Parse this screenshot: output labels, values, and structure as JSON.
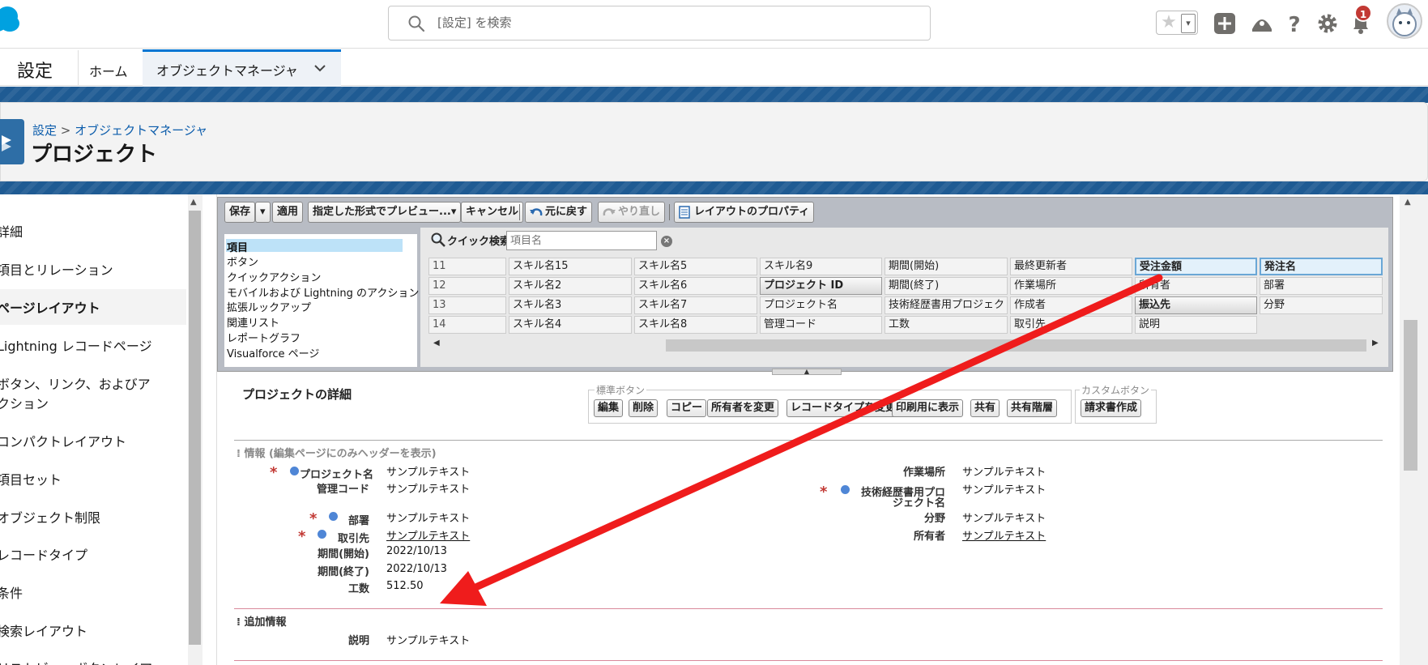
{
  "header": {
    "search_placeholder": "[設定] を検索",
    "notification_count": "1",
    "fav_star": "★",
    "fav_dropdown": "▾"
  },
  "appnav": {
    "app_name": "設定",
    "home": "ホーム",
    "object_manager": "オブジェクトマネージャ"
  },
  "page": {
    "breadcrumb_root": "設定",
    "breadcrumb_sep": " > ",
    "breadcrumb_current": "オブジェクトマネージャ",
    "title": "プロジェクト"
  },
  "leftnav": [
    "詳細",
    "項目とリレーション",
    "ページレイアウト",
    "Lightning レコードページ",
    "ボタン、リンク、およびア",
    "クション",
    "コンパクトレイアウト",
    "項目セット",
    "オブジェクト制限",
    "レコードタイプ",
    "条件",
    "検索レイアウト",
    "リストビューボタンレイア"
  ],
  "toolbar": {
    "save": "保存",
    "save_drop": "▾",
    "apply": "適用",
    "preview": "指定した形式でプレビュー...▾",
    "cancel": "キャンセル",
    "undo": "元に戻す",
    "redo": "やり直し",
    "properties": "レイアウトのプロパティ"
  },
  "categories": [
    "項目",
    "ボタン",
    "クイックアクション",
    "モバイルおよび Lightning のアクション",
    "拡張ルックアップ",
    "関連リスト",
    "レポートグラフ",
    "Visualforce ページ"
  ],
  "quick_search": {
    "label": "クイック検索",
    "placeholder": "項目名",
    "clear": "×"
  },
  "field_grid": [
    [
      "11",
      "スキル名15",
      "スキル名5",
      "スキル名9",
      "期間(開始)",
      "最終更新者",
      "受注金額",
      "発注名"
    ],
    [
      "12",
      "スキル名2",
      "スキル名6",
      "プロジェクト ID",
      "期間(終了)",
      "作業場所",
      "所有者",
      "部署"
    ],
    [
      "13",
      "スキル名3",
      "スキル名7",
      "プロジェクト名",
      "技術経歴書用プロジェクト名",
      "作成者",
      "振込先",
      "分野"
    ],
    [
      "14",
      "スキル名4",
      "スキル名8",
      "管理コード",
      "工数",
      "取引先",
      "説明",
      ""
    ]
  ],
  "detail": {
    "title": "プロジェクトの詳細",
    "standard_buttons_label": "標準ボタン",
    "custom_buttons_label": "カスタムボタン",
    "standard_buttons": [
      "編集",
      "削除",
      "コピー",
      "所有者を変更",
      "レコードタイプを変更",
      "印刷用に表示",
      "共有",
      "共有階層"
    ],
    "custom_buttons": [
      "請求書作成"
    ]
  },
  "section_info": {
    "header": "情報 (編集ページにのみヘッダーを表示)",
    "left_fields": [
      {
        "label": "プロジェクト名",
        "value": "サンプルテキスト"
      },
      {
        "label": "管理コード",
        "value": "サンプルテキスト"
      },
      {
        "label": "部署",
        "value": "サンプルテキスト"
      },
      {
        "label": "取引先",
        "value": "サンプルテキスト"
      },
      {
        "label": "期間(開始)",
        "value": "2022/10/13"
      },
      {
        "label": "期間(終了)",
        "value": "2022/10/13"
      },
      {
        "label": "工数",
        "value": "512.50"
      }
    ],
    "right_fields": [
      {
        "label": "作業場所",
        "value": "サンプルテキスト"
      },
      {
        "label": "技術経歴書用プロ",
        "label2": "ジェクト名",
        "value": "サンプルテキスト"
      },
      {
        "label": "分野",
        "value": "サンプルテキスト"
      },
      {
        "label": "所有者",
        "value": "サンプルテキスト"
      }
    ]
  },
  "section_extra": {
    "header": "追加情報",
    "fields": [
      {
        "label": "説明",
        "value": "サンプルテキスト"
      }
    ]
  },
  "colors": {
    "brand_blue": "#0176d3",
    "banner": "#1f5b93",
    "required": "#c23934",
    "arrow": "#ef1c1c"
  }
}
